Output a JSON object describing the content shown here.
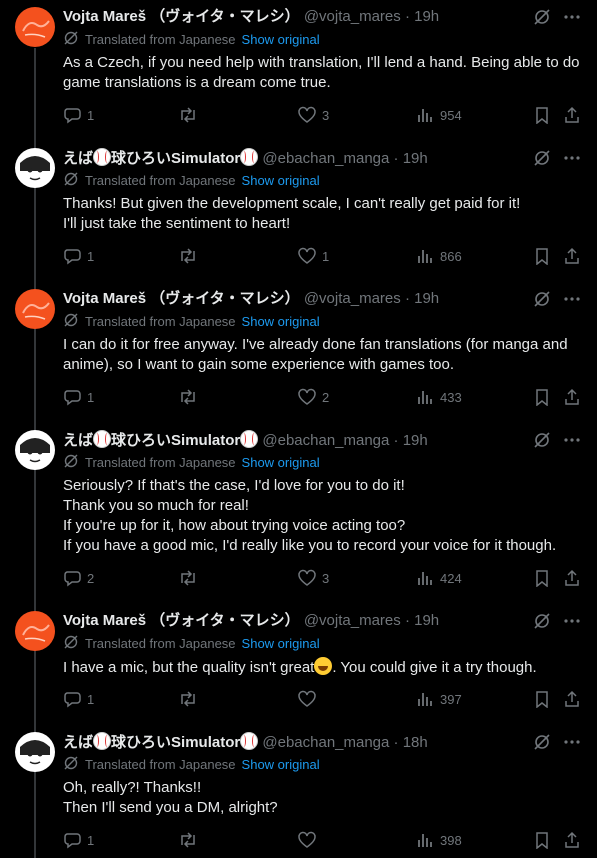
{
  "translated_label": "Translated from Japanese",
  "show_original_label": "Show original",
  "tweets": [
    {
      "author": "vojta",
      "name": "Vojta Mareš （ヴォイタ・マレシ）",
      "handle": "@vojta_mares",
      "dot": "·",
      "time": "19h",
      "lines": [
        "As a Czech, if you need help with translation, I'll lend a hand. Being able to do game translations is a dream come true."
      ],
      "replies": "1",
      "reposts": "",
      "likes": "3",
      "views": "954"
    },
    {
      "author": "ebachan",
      "name_parts": [
        "えば",
        "球ひろいSimulator"
      ],
      "handle": "@ebachan_manga",
      "dot": "·",
      "time": "19h",
      "lines": [
        "Thanks! But given the development scale, I can't really get paid for it!",
        "I'll just take the sentiment to heart!"
      ],
      "replies": "1",
      "reposts": "",
      "likes": "1",
      "views": "866"
    },
    {
      "author": "vojta",
      "name": "Vojta Mareš （ヴォイタ・マレシ）",
      "handle": "@vojta_mares",
      "dot": "·",
      "time": "19h",
      "lines": [
        "I can do it for free anyway. I've already done fan translations (for manga and anime), so I want to gain some experience with games too."
      ],
      "replies": "1",
      "reposts": "",
      "likes": "2",
      "views": "433"
    },
    {
      "author": "ebachan",
      "name_parts": [
        "えば",
        "球ひろいSimulator"
      ],
      "handle": "@ebachan_manga",
      "dot": "·",
      "time": "19h",
      "lines": [
        "Seriously? If that's the case, I'd love for you to do it!",
        "Thank you so much for real!",
        "If you're up for it, how about trying voice acting too?",
        "If you have a good mic, I'd really like you to record your voice for it though."
      ],
      "replies": "2",
      "reposts": "",
      "likes": "3",
      "views": "424"
    },
    {
      "author": "vojta",
      "name": "Vojta Mareš （ヴォイタ・マレシ）",
      "handle": "@vojta_mares",
      "dot": "·",
      "time": "19h",
      "lines_emoji": [
        "I have a mic, but the quality isn't great",
        ". You could give it a try though."
      ],
      "replies": "1",
      "reposts": "",
      "likes": "",
      "views": "397"
    },
    {
      "author": "ebachan",
      "name_parts": [
        "えば",
        "球ひろいSimulator"
      ],
      "handle": "@ebachan_manga",
      "dot": "·",
      "time": "18h",
      "lines": [
        "Oh, really?! Thanks!!",
        "Then I'll send you a DM, alright?"
      ],
      "replies": "1",
      "reposts": "",
      "likes": "",
      "views": "398"
    }
  ]
}
